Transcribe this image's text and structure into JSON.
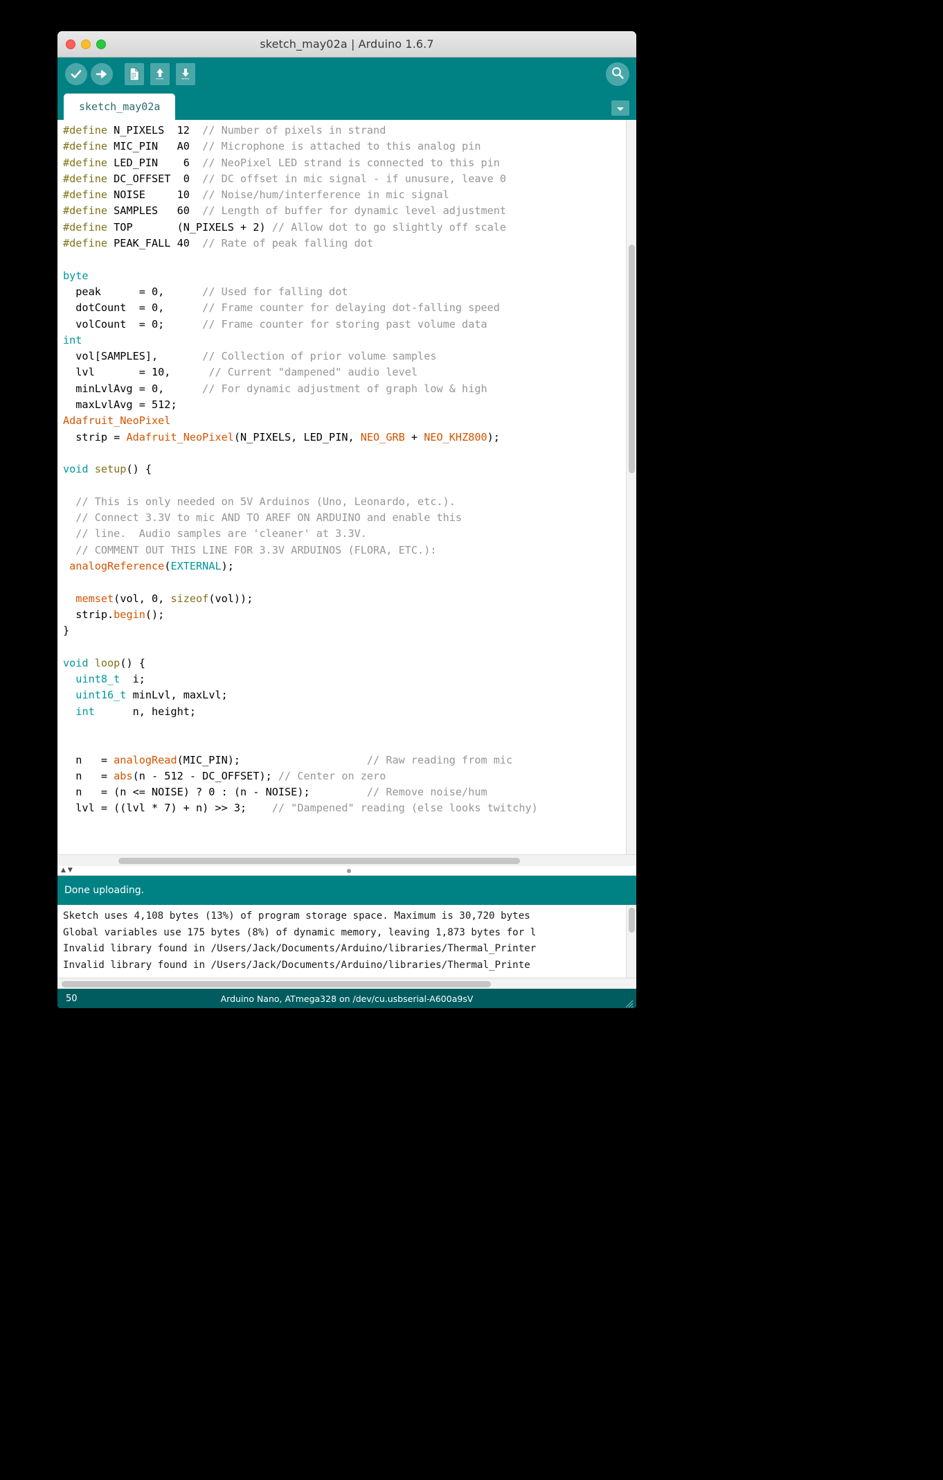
{
  "window": {
    "title": "sketch_may02a | Arduino 1.6.7",
    "traffic_lights": [
      "close",
      "minimize",
      "zoom"
    ]
  },
  "toolbar": {
    "verify_label": "Verify",
    "upload_label": "Upload",
    "new_label": "New",
    "open_label": "Open",
    "save_label": "Save",
    "serial_monitor_label": "Serial Monitor",
    "background_color": "#008184"
  },
  "tabbar": {
    "tab_label": "sketch_may02a",
    "menu_label": "Tab menu"
  },
  "editor": {
    "code": "#define N_PIXELS  12  // Number of pixels in strand\n#define MIC_PIN   A0  // Microphone is attached to this analog pin\n#define LED_PIN    6  // NeoPixel LED strand is connected to this pin\n#define DC_OFFSET  0  // DC offset in mic signal - if unusure, leave 0\n#define NOISE     10  // Noise/hum/interference in mic signal\n#define SAMPLES   60  // Length of buffer for dynamic level adjustment\n#define TOP       (N_PIXELS + 2) // Allow dot to go slightly off scale\n#define PEAK_FALL 40  // Rate of peak falling dot\n\nbyte\n  peak      = 0,      // Used for falling dot\n  dotCount  = 0,      // Frame counter for delaying dot-falling speed\n  volCount  = 0;      // Frame counter for storing past volume data\nint\n  vol[SAMPLES],       // Collection of prior volume samples\n  lvl       = 10,      // Current \"dampened\" audio level\n  minLvlAvg = 0,      // For dynamic adjustment of graph low & high\n  maxLvlAvg = 512;\nAdafruit_NeoPixel\n  strip = Adafruit_NeoPixel(N_PIXELS, LED_PIN, NEO_GRB + NEO_KHZ800);\n\nvoid setup() {\n\n  // This is only needed on 5V Arduinos (Uno, Leonardo, etc.).\n  // Connect 3.3V to mic AND TO AREF ON ARDUINO and enable this\n  // line.  Audio samples are 'cleaner' at 3.3V.\n  // COMMENT OUT THIS LINE FOR 3.3V ARDUINOS (FLORA, ETC.):\n analogReference(EXTERNAL);\n\n  memset(vol, 0, sizeof(vol));\n  strip.begin();\n}\n\nvoid loop() {\n  uint8_t  i;\n  uint16_t minLvl, maxLvl;\n  int      n, height;\n\n\n  n   = analogRead(MIC_PIN);                    // Raw reading from mic\n  n   = abs(n - 512 - DC_OFFSET); // Center on zero\n  n   = (n <= NOISE) ? 0 : (n - NOISE);         // Remove noise/hum\n  lvl = ((lvl * 7) + n) >> 3;    // \"Dampened\" reading (else looks twitchy)",
    "lines": [
      {
        "t": "preproc",
        "parts": [
          [
            "kw2",
            "#define"
          ],
          [
            "op",
            " N_PIXELS  12  "
          ],
          [
            "cm",
            "// Number of pixels in strand"
          ]
        ]
      },
      {
        "t": "preproc",
        "parts": [
          [
            "kw2",
            "#define"
          ],
          [
            "op",
            " MIC_PIN   A0  "
          ],
          [
            "cm",
            "// Microphone is attached to this analog pin"
          ]
        ]
      },
      {
        "t": "preproc",
        "parts": [
          [
            "kw2",
            "#define"
          ],
          [
            "op",
            " LED_PIN    6  "
          ],
          [
            "cm",
            "// NeoPixel LED strand is connected to this pin"
          ]
        ]
      },
      {
        "t": "preproc",
        "parts": [
          [
            "kw2",
            "#define"
          ],
          [
            "op",
            " DC_OFFSET  0  "
          ],
          [
            "cm",
            "// DC offset in mic signal - if unusure, leave 0"
          ]
        ]
      },
      {
        "t": "preproc",
        "parts": [
          [
            "kw2",
            "#define"
          ],
          [
            "op",
            " NOISE     10  "
          ],
          [
            "cm",
            "// Noise/hum/interference in mic signal"
          ]
        ]
      },
      {
        "t": "preproc",
        "parts": [
          [
            "kw2",
            "#define"
          ],
          [
            "op",
            " SAMPLES   60  "
          ],
          [
            "cm",
            "// Length of buffer for dynamic level adjustment"
          ]
        ]
      },
      {
        "t": "preproc",
        "parts": [
          [
            "kw2",
            "#define"
          ],
          [
            "op",
            " TOP       (N_PIXELS + 2) "
          ],
          [
            "cm",
            "// Allow dot to go slightly off scale"
          ]
        ]
      },
      {
        "t": "preproc",
        "parts": [
          [
            "kw2",
            "#define"
          ],
          [
            "op",
            " PEAK_FALL 40  "
          ],
          [
            "cm",
            "// Rate of peak falling dot"
          ]
        ]
      }
    ]
  },
  "status": {
    "message": "Done uploading.",
    "background_color": "#008184"
  },
  "console": {
    "lines": [
      "Sketch uses 4,108 bytes (13%) of program storage space. Maximum is 30,720 bytes",
      "Global variables use 175 bytes (8%) of dynamic memory, leaving 1,873 bytes for l",
      "Invalid library found in /Users/Jack/Documents/Arduino/libraries/Thermal_Printer",
      "Invalid library found in /Users/Jack/Documents/Arduino/libraries/Thermal_Printe"
    ]
  },
  "bottom_bar": {
    "line_number": "50",
    "board_info": "Arduino Nano, ATmega328 on /dev/cu.usbserial-A600a9sV",
    "background_color": "#005c5f"
  },
  "colors": {
    "teal": "#008184",
    "teal_dark": "#005c5f",
    "keyword_type": "#00979c",
    "keyword_define": "#7e7219",
    "function": "#d35400",
    "comment": "#969696"
  }
}
